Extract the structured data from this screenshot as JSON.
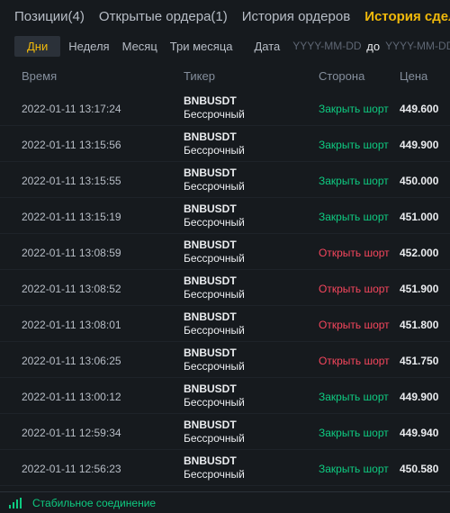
{
  "tabs": [
    {
      "label": "Позиции(4)",
      "active": false
    },
    {
      "label": "Открытые ордера(1)",
      "active": false
    },
    {
      "label": "История ордеров",
      "active": false
    },
    {
      "label": "История сделок",
      "active": true
    }
  ],
  "filters": {
    "periods": [
      "Дни",
      "Неделя",
      "Месяц",
      "Три месяца"
    ],
    "active_period": "Дни",
    "date_label": "Дата",
    "from_placeholder": "YYYY-MM-DD",
    "separator": "до",
    "to_placeholder": "YYYY-MM-DD"
  },
  "table": {
    "columns": [
      "Время",
      "Тикер",
      "Сторона",
      "Цена"
    ],
    "rows": [
      {
        "time": "2022-01-11 13:17:24",
        "symbol": "BNBUSDT",
        "type": "Бессрочный",
        "side": "Закрыть шорт",
        "side_kind": "close",
        "price": "449.600"
      },
      {
        "time": "2022-01-11 13:15:56",
        "symbol": "BNBUSDT",
        "type": "Бессрочный",
        "side": "Закрыть шорт",
        "side_kind": "close",
        "price": "449.900"
      },
      {
        "time": "2022-01-11 13:15:55",
        "symbol": "BNBUSDT",
        "type": "Бессрочный",
        "side": "Закрыть шорт",
        "side_kind": "close",
        "price": "450.000"
      },
      {
        "time": "2022-01-11 13:15:19",
        "symbol": "BNBUSDT",
        "type": "Бессрочный",
        "side": "Закрыть шорт",
        "side_kind": "close",
        "price": "451.000"
      },
      {
        "time": "2022-01-11 13:08:59",
        "symbol": "BNBUSDT",
        "type": "Бессрочный",
        "side": "Открыть шорт",
        "side_kind": "open",
        "price": "452.000"
      },
      {
        "time": "2022-01-11 13:08:52",
        "symbol": "BNBUSDT",
        "type": "Бессрочный",
        "side": "Открыть шорт",
        "side_kind": "open",
        "price": "451.900"
      },
      {
        "time": "2022-01-11 13:08:01",
        "symbol": "BNBUSDT",
        "type": "Бессрочный",
        "side": "Открыть шорт",
        "side_kind": "open",
        "price": "451.800"
      },
      {
        "time": "2022-01-11 13:06:25",
        "symbol": "BNBUSDT",
        "type": "Бессрочный",
        "side": "Открыть шорт",
        "side_kind": "open",
        "price": "451.750"
      },
      {
        "time": "2022-01-11 13:00:12",
        "symbol": "BNBUSDT",
        "type": "Бессрочный",
        "side": "Закрыть шорт",
        "side_kind": "close",
        "price": "449.900"
      },
      {
        "time": "2022-01-11 12:59:34",
        "symbol": "BNBUSDT",
        "type": "Бессрочный",
        "side": "Закрыть шорт",
        "side_kind": "close",
        "price": "449.940"
      },
      {
        "time": "2022-01-11 12:56:23",
        "symbol": "BNBUSDT",
        "type": "Бессрочный",
        "side": "Закрыть шорт",
        "side_kind": "close",
        "price": "450.580"
      }
    ]
  },
  "status": {
    "icon": "signal-bars-icon",
    "text": "Стабильное соединение"
  },
  "colors": {
    "background": "#161a1e",
    "accent": "#f0b90b",
    "close_short": "#0ecb81",
    "open_short": "#f6465d"
  }
}
